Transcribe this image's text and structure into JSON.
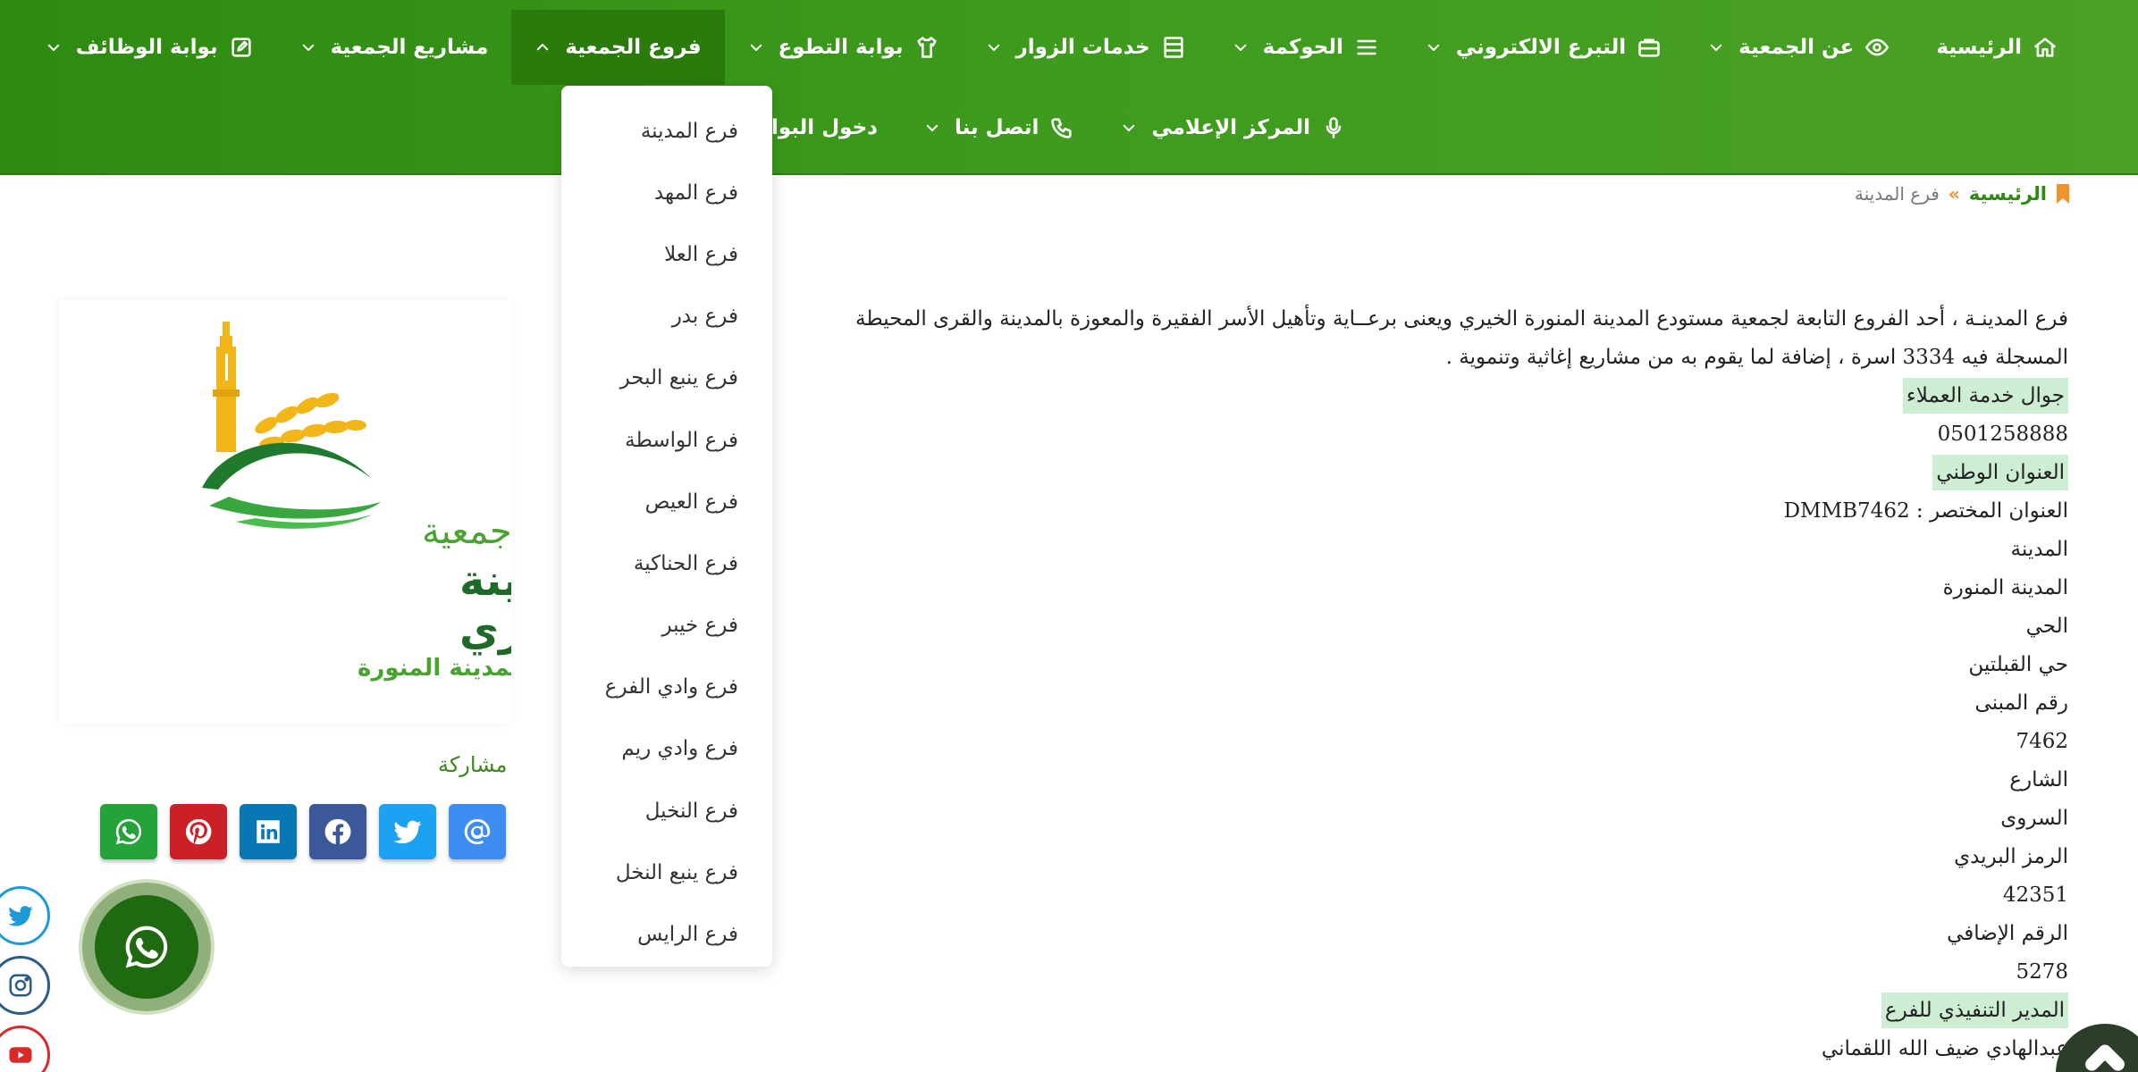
{
  "colors": {
    "nav_green": "#3e9b1d",
    "nav_active": "#2b7a0c",
    "highlight": "#cdeed3",
    "breadcrumb_home": "#2e8a10",
    "breadcrumb_sep": "#f0932b"
  },
  "nav": {
    "row1": [
      {
        "label": "الرئيسية",
        "icon": "home-icon",
        "dropdown": false
      },
      {
        "label": "عن الجمعية",
        "icon": "eye-icon",
        "dropdown": true
      },
      {
        "label": "التبرع الالكتروني",
        "icon": "briefcase-icon",
        "dropdown": true
      },
      {
        "label": "الحوكمة",
        "icon": "menu-lines-icon",
        "dropdown": true
      },
      {
        "label": "خدمات الزوار",
        "icon": "server-icon",
        "dropdown": true
      },
      {
        "label": "بوابة التطوع",
        "icon": "shirt-icon",
        "dropdown": true
      },
      {
        "label": "فروع الجمعية",
        "icon": "",
        "dropdown": true,
        "active": true
      },
      {
        "label": "مشاريع الجمعية",
        "icon": "",
        "dropdown": true
      },
      {
        "label": "بوابة الوظائف",
        "icon": "edit-icon",
        "dropdown": true
      }
    ],
    "row2": [
      {
        "label": "المركز الإعلامي",
        "icon": "microphone-icon",
        "dropdown": true
      },
      {
        "label": "اتصل بنا",
        "icon": "phone-icon",
        "dropdown": true
      },
      {
        "label": "دخول البوابة للموظفين",
        "icon": "",
        "dropdown": false
      }
    ]
  },
  "branches_dropdown": [
    "فرع المدينة",
    "فرع المهد",
    "فرع العلا",
    "فرع بدر",
    "فرع ينبع البحر",
    "فرع الواسطة",
    "فرع العيص",
    "فرع الحناكية",
    "فرع خيبر",
    "فرع وادي الفرع",
    "فرع وادي ريم",
    "فرع النخيل",
    "فرع ينبع النخل",
    "فرع الرايس"
  ],
  "breadcrumb": {
    "home": "الرئيسية",
    "separator": "»",
    "current": "فرع المدينة"
  },
  "content": {
    "intro_line1": "فرع المدينـة ، أحد الفروع التابعة لجمعية مستودع المدينة المنورة الخيري ويعنى برعــاية وتأهيل الأسر الفقيرة والمعوزة بالمدينة والقرى المحيطة",
    "intro_line2": "المسجلة فيه 3334 اسرة ، إضافة لما يقوم به من مشاريع إغاثية وتنموية .",
    "lines": [
      {
        "text": "جوال خدمة العملاء",
        "highlight": true
      },
      {
        "text": "0501258888",
        "highlight": false
      },
      {
        "text": "العنوان الوطني",
        "highlight": true
      },
      {
        "text": "العنوان المختصر : DMMB7462",
        "highlight": false
      },
      {
        "text": "المدينة",
        "highlight": false
      },
      {
        "text": "المدينة المنورة",
        "highlight": false
      },
      {
        "text": "الحي",
        "highlight": false
      },
      {
        "text": "حي القبلتين",
        "highlight": false
      },
      {
        "text": "رقم المبنى",
        "highlight": false
      },
      {
        "text": "7462",
        "highlight": false
      },
      {
        "text": "الشارع",
        "highlight": false
      },
      {
        "text": "السروى",
        "highlight": false
      },
      {
        "text": "الرمز البريدي",
        "highlight": false
      },
      {
        "text": "42351",
        "highlight": false
      },
      {
        "text": "الرقم الإضافي",
        "highlight": false
      },
      {
        "text": "5278",
        "highlight": false
      },
      {
        "text": "المدير التنفيذي للفرع",
        "highlight": true
      },
      {
        "text": "عبدالهادي ضيف الله اللقماني",
        "highlight": false
      }
    ]
  },
  "logo": {
    "line1": "جمعية",
    "line2": "مستودع المدينة",
    "line3": "المنورة الخيـــري",
    "line4": "فرع المدينة المنورة"
  },
  "share": {
    "title": "مشاركة",
    "buttons": [
      {
        "name": "email",
        "color": "#3d8ef0"
      },
      {
        "name": "twitter",
        "color": "#1da1f2"
      },
      {
        "name": "facebook",
        "color": "#3b5998"
      },
      {
        "name": "linkedin",
        "color": "#0a77b5"
      },
      {
        "name": "pinterest",
        "color": "#cb2027"
      },
      {
        "name": "whatsapp",
        "color": "#25a33a"
      }
    ]
  }
}
